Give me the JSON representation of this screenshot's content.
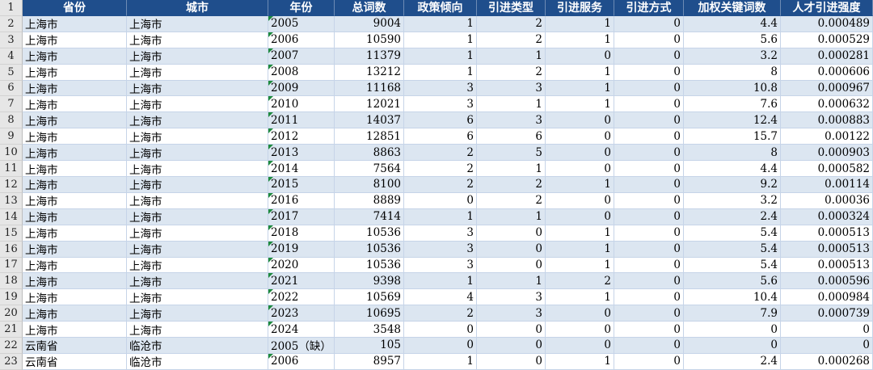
{
  "sheet": {
    "header": {
      "row_number": "1",
      "columns": [
        "省份",
        "城市",
        "年份",
        "总词数",
        "政策倾向",
        "引进类型",
        "引进服务",
        "引进方式",
        "加权关键词数",
        "人才引进强度"
      ]
    },
    "rows": [
      {
        "row_number": "2",
        "cells": [
          "上海市",
          "上海市",
          "2005",
          "9004",
          "1",
          "2",
          "1",
          "0",
          "4.4",
          "0.000489"
        ],
        "year_marker": true
      },
      {
        "row_number": "3",
        "cells": [
          "上海市",
          "上海市",
          "2006",
          "10590",
          "1",
          "2",
          "1",
          "0",
          "5.6",
          "0.000529"
        ],
        "year_marker": true
      },
      {
        "row_number": "4",
        "cells": [
          "上海市",
          "上海市",
          "2007",
          "11379",
          "1",
          "1",
          "0",
          "0",
          "3.2",
          "0.000281"
        ],
        "year_marker": true
      },
      {
        "row_number": "5",
        "cells": [
          "上海市",
          "上海市",
          "2008",
          "13212",
          "1",
          "2",
          "1",
          "0",
          "8",
          "0.000606"
        ],
        "year_marker": true
      },
      {
        "row_number": "6",
        "cells": [
          "上海市",
          "上海市",
          "2009",
          "11168",
          "3",
          "3",
          "1",
          "0",
          "10.8",
          "0.000967"
        ],
        "year_marker": true
      },
      {
        "row_number": "7",
        "cells": [
          "上海市",
          "上海市",
          "2010",
          "12021",
          "3",
          "1",
          "1",
          "0",
          "7.6",
          "0.000632"
        ],
        "year_marker": true
      },
      {
        "row_number": "8",
        "cells": [
          "上海市",
          "上海市",
          "2011",
          "14037",
          "6",
          "3",
          "0",
          "0",
          "12.4",
          "0.000883"
        ],
        "year_marker": true
      },
      {
        "row_number": "9",
        "cells": [
          "上海市",
          "上海市",
          "2012",
          "12851",
          "6",
          "6",
          "0",
          "0",
          "15.7",
          "0.00122"
        ],
        "year_marker": true
      },
      {
        "row_number": "10",
        "cells": [
          "上海市",
          "上海市",
          "2013",
          "8863",
          "2",
          "5",
          "0",
          "0",
          "8",
          "0.000903"
        ],
        "year_marker": true
      },
      {
        "row_number": "11",
        "cells": [
          "上海市",
          "上海市",
          "2014",
          "7564",
          "2",
          "1",
          "0",
          "0",
          "4.4",
          "0.000582"
        ],
        "year_marker": true
      },
      {
        "row_number": "12",
        "cells": [
          "上海市",
          "上海市",
          "2015",
          "8100",
          "2",
          "2",
          "1",
          "0",
          "9.2",
          "0.00114"
        ],
        "year_marker": true
      },
      {
        "row_number": "13",
        "cells": [
          "上海市",
          "上海市",
          "2016",
          "8889",
          "0",
          "2",
          "0",
          "0",
          "3.2",
          "0.00036"
        ],
        "year_marker": true
      },
      {
        "row_number": "14",
        "cells": [
          "上海市",
          "上海市",
          "2017",
          "7414",
          "1",
          "1",
          "0",
          "0",
          "2.4",
          "0.000324"
        ],
        "year_marker": true
      },
      {
        "row_number": "15",
        "cells": [
          "上海市",
          "上海市",
          "2018",
          "10536",
          "3",
          "0",
          "1",
          "0",
          "5.4",
          "0.000513"
        ],
        "year_marker": true
      },
      {
        "row_number": "16",
        "cells": [
          "上海市",
          "上海市",
          "2019",
          "10536",
          "3",
          "0",
          "1",
          "0",
          "5.4",
          "0.000513"
        ],
        "year_marker": true
      },
      {
        "row_number": "17",
        "cells": [
          "上海市",
          "上海市",
          "2020",
          "10536",
          "3",
          "0",
          "1",
          "0",
          "5.4",
          "0.000513"
        ],
        "year_marker": true
      },
      {
        "row_number": "18",
        "cells": [
          "上海市",
          "上海市",
          "2021",
          "9398",
          "1",
          "1",
          "2",
          "0",
          "5.6",
          "0.000596"
        ],
        "year_marker": true
      },
      {
        "row_number": "19",
        "cells": [
          "上海市",
          "上海市",
          "2022",
          "10569",
          "4",
          "3",
          "1",
          "0",
          "10.4",
          "0.000984"
        ],
        "year_marker": true
      },
      {
        "row_number": "20",
        "cells": [
          "上海市",
          "上海市",
          "2023",
          "10695",
          "2",
          "3",
          "0",
          "0",
          "7.9",
          "0.000739"
        ],
        "year_marker": true
      },
      {
        "row_number": "21",
        "cells": [
          "上海市",
          "上海市",
          "2024",
          "3548",
          "0",
          "0",
          "0",
          "0",
          "0",
          "0"
        ],
        "year_marker": true
      },
      {
        "row_number": "22",
        "cells": [
          "云南省",
          "临沧市",
          "2005（缺）",
          "105",
          "0",
          "0",
          "0",
          "0",
          "0",
          "0"
        ],
        "year_marker": false
      },
      {
        "row_number": "23",
        "cells": [
          "云南省",
          "临沧市",
          "2006",
          "8957",
          "1",
          "0",
          "1",
          "0",
          "2.4",
          "0.000268"
        ],
        "year_marker": true
      }
    ]
  },
  "colors": {
    "header_fill": "#1F4E8C",
    "header_text": "#FFFFFF",
    "band_fill": "#DCE6F1",
    "plain_fill": "#FFFFFF",
    "row_header_fill": "#E6E6E6",
    "text_marker": "#1E8A3E",
    "gridline": "#C6D4E8"
  }
}
